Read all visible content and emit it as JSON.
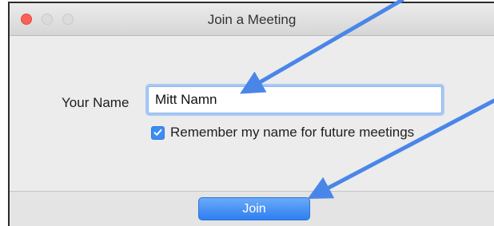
{
  "window": {
    "title": "Join a Meeting"
  },
  "form": {
    "name_label": "Your Name",
    "name_value": "Mitt Namn",
    "remember_label": "Remember my name for future meetings",
    "remember_checked": true
  },
  "footer": {
    "join_label": "Join"
  },
  "colors": {
    "close_button": "#fc5f57",
    "accent_blue": "#3b8cf4",
    "annotation_arrow": "#4a86e8"
  }
}
